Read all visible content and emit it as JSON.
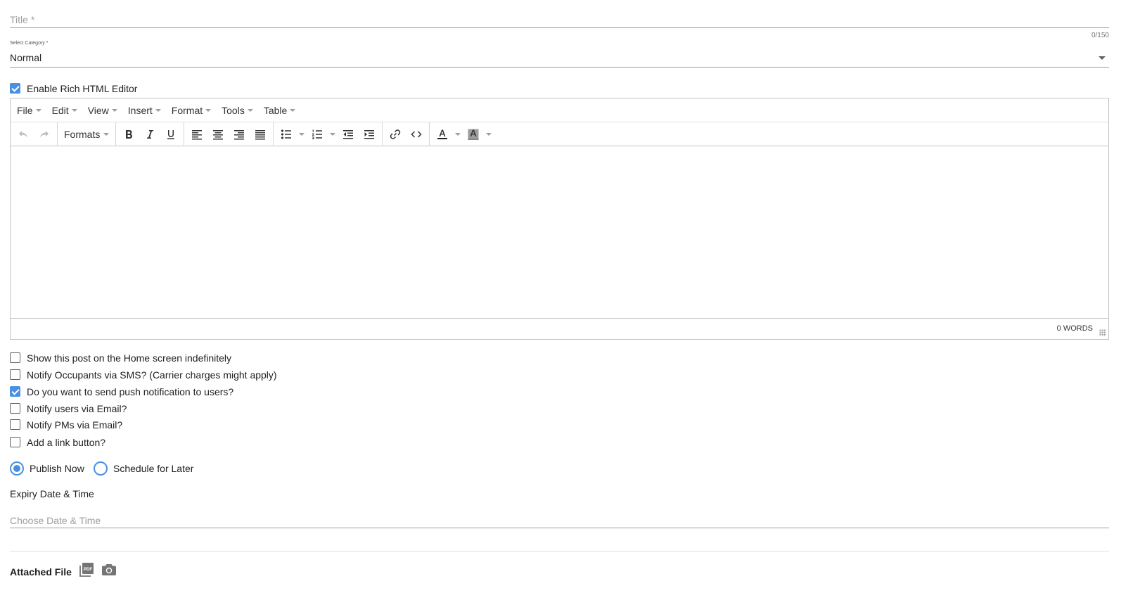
{
  "title_field": {
    "placeholder": "Title *",
    "value": "",
    "counter": "0/150"
  },
  "category": {
    "label": "Select Category",
    "required_mark": "*",
    "value": "Normal"
  },
  "rich_editor_toggle": {
    "label": "Enable Rich HTML Editor",
    "checked": true
  },
  "editor": {
    "menus": [
      "File",
      "Edit",
      "View",
      "Insert",
      "Format",
      "Tools",
      "Table"
    ],
    "formats_label": "Formats",
    "toolbar_icons": [
      "undo-icon",
      "redo-icon",
      "bold-icon",
      "italic-icon",
      "underline-icon",
      "align-left-icon",
      "align-center-icon",
      "align-right-icon",
      "align-justify-icon",
      "bullet-list-icon",
      "numbered-list-icon",
      "outdent-icon",
      "indent-icon",
      "link-icon",
      "code-icon",
      "text-color-icon",
      "background-color-icon"
    ],
    "word_count": "0 WORDS"
  },
  "options": [
    {
      "label": "Show this post on the Home screen indefinitely",
      "checked": false
    },
    {
      "label": "Notify Occupants via SMS? (Carrier charges might apply)",
      "checked": false
    },
    {
      "label": "Do you want to send push notification to users?",
      "checked": true
    },
    {
      "label": "Notify users via Email?",
      "checked": false
    },
    {
      "label": "Notify PMs via Email?",
      "checked": false
    },
    {
      "label": "Add a link button?",
      "checked": false
    }
  ],
  "publish": {
    "now_label": "Publish Now",
    "later_label": "Schedule for Later",
    "selected": "now"
  },
  "expiry": {
    "label": "Expiry Date & Time",
    "placeholder": "Choose Date & Time"
  },
  "attachments": {
    "label": "Attached File",
    "icons": [
      "pdf-icon",
      "camera-icon"
    ]
  },
  "colors": {
    "accent": "#4a90e2",
    "line": "#9e9e9e"
  }
}
